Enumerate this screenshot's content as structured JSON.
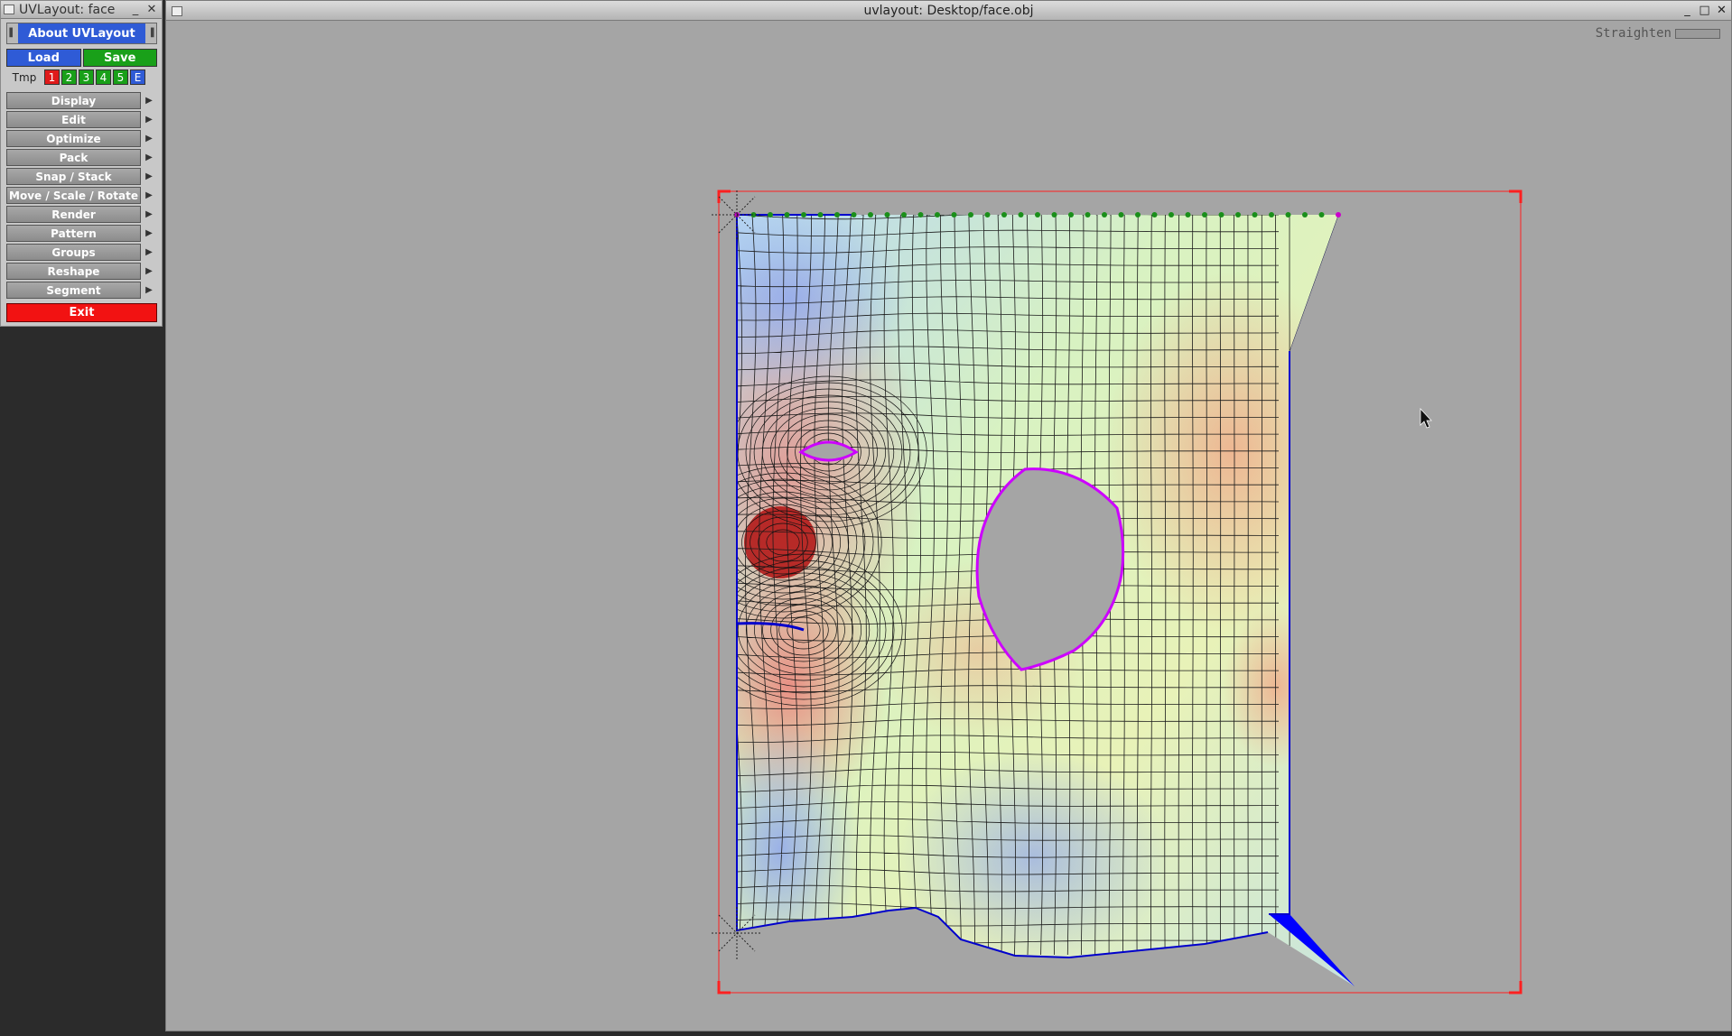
{
  "tool_window": {
    "title": "UVLayout: face",
    "about_label": "About UVLayout",
    "load_label": "Load",
    "save_label": "Save",
    "tmp_label": "Tmp",
    "tmp_slots": [
      "1",
      "2",
      "3",
      "4",
      "5",
      "E"
    ],
    "menu_items": [
      "Display",
      "Edit",
      "Optimize",
      "Pack",
      "Snap / Stack",
      "Move / Scale / Rotate",
      "Render",
      "Pattern",
      "Groups",
      "Reshape",
      "Segment"
    ],
    "exit_label": "Exit"
  },
  "main_window": {
    "title": "uvlayout: Desktop/face.obj",
    "straighten_label": "Straighten"
  },
  "colors": {
    "accent_blue": "#2f5bd6",
    "save_green": "#19a019",
    "exit_red": "#f21212",
    "uv_border_blue": "#0000ff",
    "hole_outline_magenta": "#cc00ff",
    "bounding_box_red": "#ff2020",
    "viewport_bg": "#a5a5a5"
  },
  "icons": {
    "cursor": "mouse-pointer-icon",
    "pin": "asterisk-pin-icon"
  }
}
